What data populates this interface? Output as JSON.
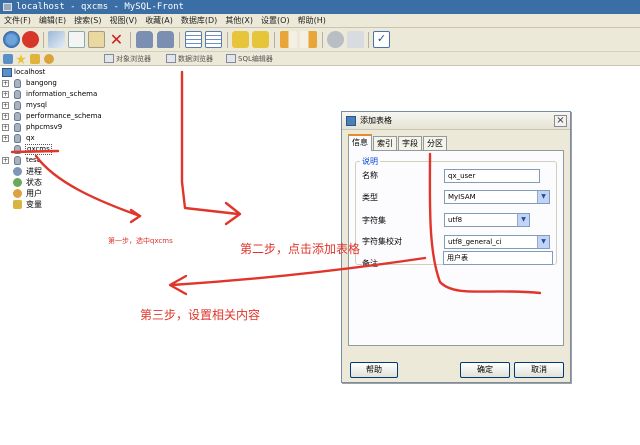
{
  "window": {
    "title": "localhost - qxcms - MySQL-Front"
  },
  "menu": [
    "文件(F)",
    "编辑(E)",
    "搜索(S)",
    "视图(V)",
    "收藏(A)",
    "数据库(D)",
    "其他(X)",
    "设置(O)",
    "帮助(H)"
  ],
  "toolbar2": {
    "tabs": [
      "对象浏览器",
      "数据浏览器",
      "SQL编辑器"
    ]
  },
  "tree": {
    "root": "localhost",
    "databases": [
      "bangong",
      "information_schema",
      "mysql",
      "performance_schema",
      "phpcmsv9",
      "qx",
      "qxcms",
      "test"
    ],
    "extras": [
      "进程",
      "状态",
      "用户",
      "变量"
    ]
  },
  "annotations": {
    "step1": "第一步，选中qxcms",
    "step2": "第二步，点击添加表格",
    "step3": "第三步，设置相关内容"
  },
  "dialog": {
    "title": "添加表格",
    "tabs": [
      "信息",
      "索引",
      "字段",
      "分区"
    ],
    "group_label": "说明",
    "fields": {
      "name_label": "名称",
      "name_value": "qx_user",
      "type_label": "类型",
      "type_value": "MyISAM",
      "charset_label": "字符集",
      "charset_value": "utf8",
      "collation_label": "字符集校对",
      "collation_value": "utf8_general_ci",
      "comment_label": "备注",
      "comment_value": "用户表"
    },
    "buttons": {
      "help": "帮助",
      "ok": "确定",
      "cancel": "取消"
    }
  },
  "colors": {
    "annotation": "#e0352b",
    "titlebar": "#3a6ea5",
    "tab_accent": "#e68b2c"
  }
}
